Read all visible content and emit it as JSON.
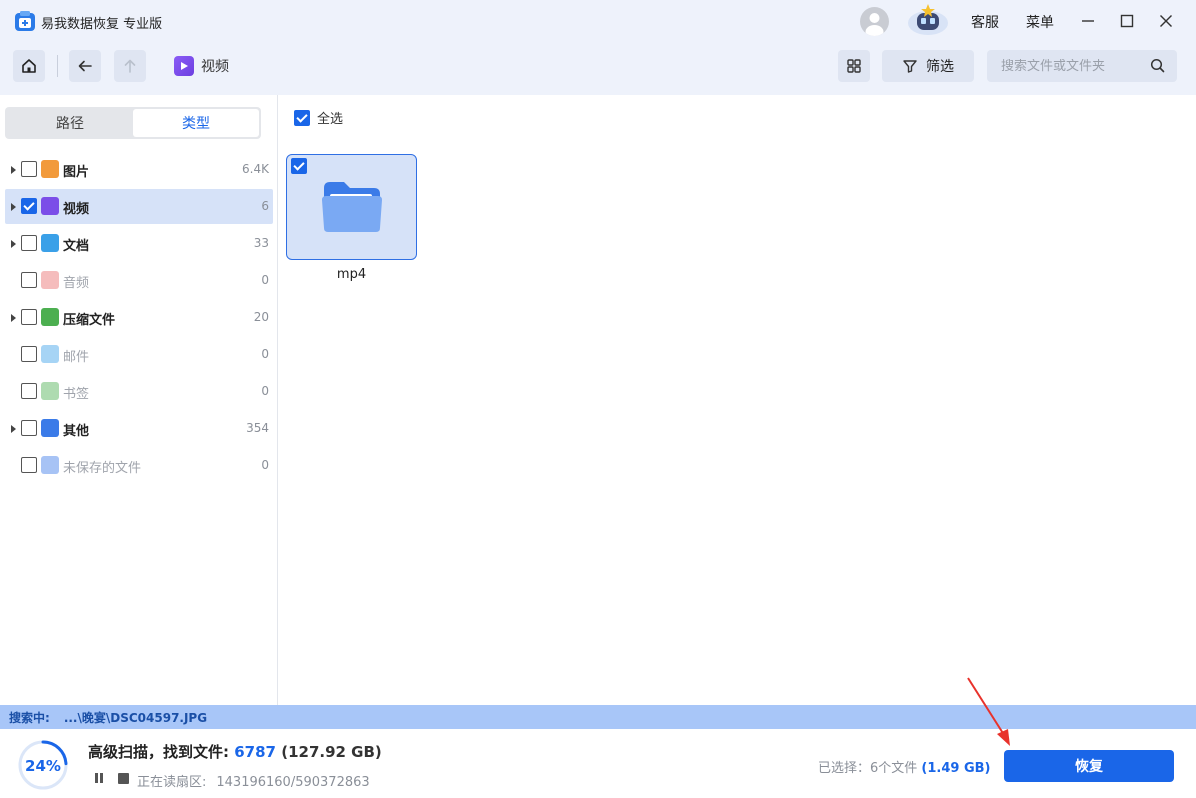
{
  "app": {
    "title": "易我数据恢复 专业版"
  },
  "titlebar": {
    "service_label": "客服",
    "menu_label": "菜单"
  },
  "toolbar": {
    "breadcrumb": "视频",
    "filter_label": "筛选",
    "search_placeholder": "搜索文件或文件夹"
  },
  "sidebar": {
    "tabs": [
      {
        "label": "路径"
      },
      {
        "label": "类型"
      }
    ],
    "categories": [
      {
        "label": "图片",
        "count": "6.4K",
        "checked": false,
        "expandable": true,
        "enabled": true,
        "icon": "picture-icon",
        "color": "#f29a3b"
      },
      {
        "label": "视频",
        "count": "6",
        "checked": true,
        "expandable": true,
        "enabled": true,
        "icon": "video-icon",
        "color": "#7b4ee8"
      },
      {
        "label": "文档",
        "count": "33",
        "checked": false,
        "expandable": true,
        "enabled": true,
        "icon": "document-icon",
        "color": "#3aa0e8"
      },
      {
        "label": "音频",
        "count": "0",
        "checked": false,
        "expandable": false,
        "enabled": false,
        "icon": "audio-icon",
        "color": "#e86b6b"
      },
      {
        "label": "压缩文件",
        "count": "20",
        "checked": false,
        "expandable": true,
        "enabled": true,
        "icon": "archive-icon",
        "color": "#4caf50"
      },
      {
        "label": "邮件",
        "count": "0",
        "checked": false,
        "expandable": false,
        "enabled": false,
        "icon": "mail-icon",
        "color": "#3aa0e8"
      },
      {
        "label": "书签",
        "count": "0",
        "checked": false,
        "expandable": false,
        "enabled": false,
        "icon": "bookmark-icon",
        "color": "#4caf50"
      },
      {
        "label": "其他",
        "count": "354",
        "checked": false,
        "expandable": true,
        "enabled": true,
        "icon": "other-folder-icon",
        "color": "#3b7be8"
      },
      {
        "label": "未保存的文件",
        "count": "0",
        "checked": false,
        "expandable": false,
        "enabled": false,
        "icon": "unsaved-file-icon",
        "color": "#3b7be8"
      }
    ]
  },
  "main": {
    "select_all_label": "全选",
    "items": [
      {
        "label": "mp4",
        "checked": true,
        "icon": "folder-icon"
      }
    ]
  },
  "status": {
    "searching_label": "搜索中:",
    "searching_path": "...\\晚宴\\DSC04597.JPG"
  },
  "footer": {
    "progress_text": "24%",
    "progress_fraction": 0.24,
    "scan_label": "高级扫描，找到文件:",
    "found_count": "6787",
    "found_size": "(127.92 GB)",
    "sector_label": "正在读扇区:",
    "sector_value": "143196160/590372863",
    "selected_label": "已选择：6个文件",
    "selected_size": "(1.49 GB)",
    "recover_label": "恢复"
  },
  "colors": {
    "accent": "#1a66e8",
    "selection": "#d6e2f8",
    "annotation_arrow": "#e8322b"
  }
}
